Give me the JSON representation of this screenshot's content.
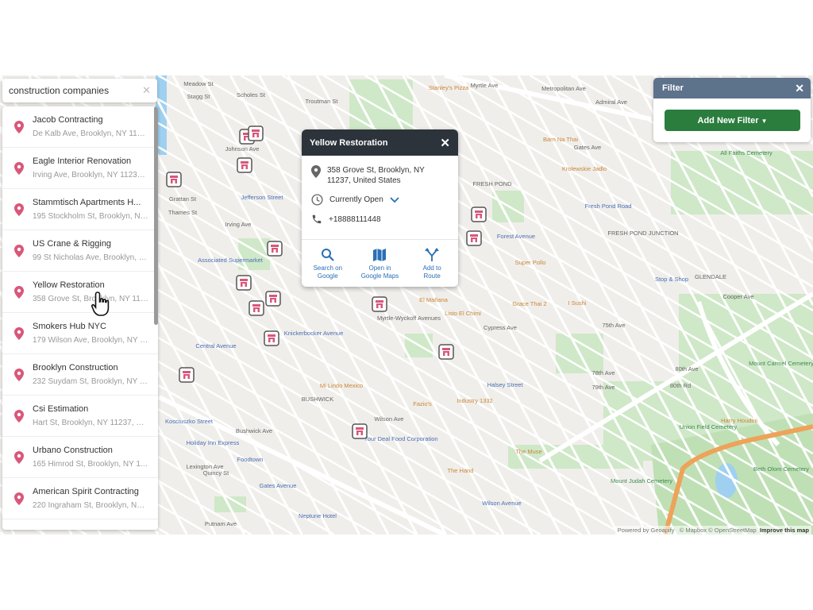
{
  "search": {
    "value": "construction companies",
    "clear_icon": "close-icon"
  },
  "results": [
    {
      "name": "Jacob Contracting",
      "address": "De Kalb Ave, Brooklyn, NY 1123..."
    },
    {
      "name": "Eagle Interior Renovation",
      "address": "Irving Ave, Brooklyn, NY 11237, ..."
    },
    {
      "name": "Stammtisch Apartments H...",
      "address": "195 Stockholm St, Brooklyn, NY ..."
    },
    {
      "name": "US Crane & Rigging",
      "address": "99 St Nicholas Ave, Brooklyn, N..."
    },
    {
      "name": "Yellow Restoration",
      "address": "358 Grove St, Brooklyn, NY 1123..."
    },
    {
      "name": "Smokers Hub NYC",
      "address": "179 Wilson Ave, Brooklyn, NY 11..."
    },
    {
      "name": "Brooklyn Construction",
      "address": "232 Suydam St, Brooklyn, NY 11..."
    },
    {
      "name": "Csi Estimation",
      "address": "Hart St, Brooklyn, NY 11237, Uni..."
    },
    {
      "name": "Urbano Construction",
      "address": "165 Himrod St, Brooklyn, NY 112..."
    },
    {
      "name": "American Spirit Contracting",
      "address": "220 Ingraham St, Brooklyn, NY 1..."
    }
  ],
  "popup": {
    "title": "Yellow Restoration",
    "address": "358 Grove St, Brooklyn, NY 11237, United States",
    "hours": "Currently Open",
    "phone": "+18888111448",
    "actions": [
      {
        "label": "Search on Google",
        "icon": "search-icon"
      },
      {
        "label": "Open in Google Maps",
        "icon": "map-icon"
      },
      {
        "label": "Add to Route",
        "icon": "route-icon"
      }
    ]
  },
  "filter": {
    "title": "Filter",
    "button": "Add New Filter"
  },
  "attribution": {
    "powered": "Powered by Geoapify",
    "copyright": "© Mapbox © OpenStreetMap",
    "improve": "Improve this map"
  },
  "colors": {
    "pin": "#d9577a",
    "filter_header": "#5d728b",
    "filter_button": "#2b7d3d",
    "popup_header": "#2d333b",
    "action": "#2a6fb5",
    "park": "#cfe8c8",
    "highway": "#eda35a"
  },
  "map_labels": [
    "Meadow St",
    "Stagg St",
    "Scholes St",
    "Johnson Ave",
    "Grattan St",
    "Thames St",
    "Irving Ave",
    "Jefferson Street",
    "Troutman St",
    "Metropolitan Ave",
    "Stanley's Pizza",
    "Admiral Ave",
    "Gates Ave",
    "Barn Na Thai",
    "Krolewskie Jadlo",
    "FRESH POND",
    "Fresh Pond Road",
    "Forest Avenue",
    "Super Pollo",
    "FRESH POND JUNCTION",
    "GLENDALE",
    "Stop & Shop",
    "Cooper Ave",
    "All Faiths Cemetery",
    "Associated Supermarket",
    "Central Avenue",
    "Knickerbocker Avenue",
    "Myrtle-Wyckoff Avenues",
    "El Mañana",
    "Listo El Chimi",
    "Grace Thai 2",
    "I Sushi",
    "Cypress Ave",
    "Mi Lindo Mexico",
    "BUSHWICK",
    "Halsey Street",
    "Industry 1332",
    "Fazio's",
    "Your Deal Food Corporation",
    "The Muse",
    "The Hand",
    "Kosciuszko Street",
    "Holiday Inn Express",
    "Foodtown",
    "Gates Avenue",
    "Neptune Hotel",
    "Wilson Avenue",
    "Bushwick Ave",
    "Lexington Ave",
    "Quincy St",
    "Putnam Ave",
    "75th Ave",
    "78th Ave",
    "79th Ave",
    "80th Ave",
    "80th Rd",
    "Mount Carmel Cemetery",
    "Union Field Cemetery",
    "Harry Houdini",
    "Mount Judah Cemetery",
    "Beth Olom Cemetery",
    "Wilson Ave",
    "Myrtle Ave"
  ]
}
